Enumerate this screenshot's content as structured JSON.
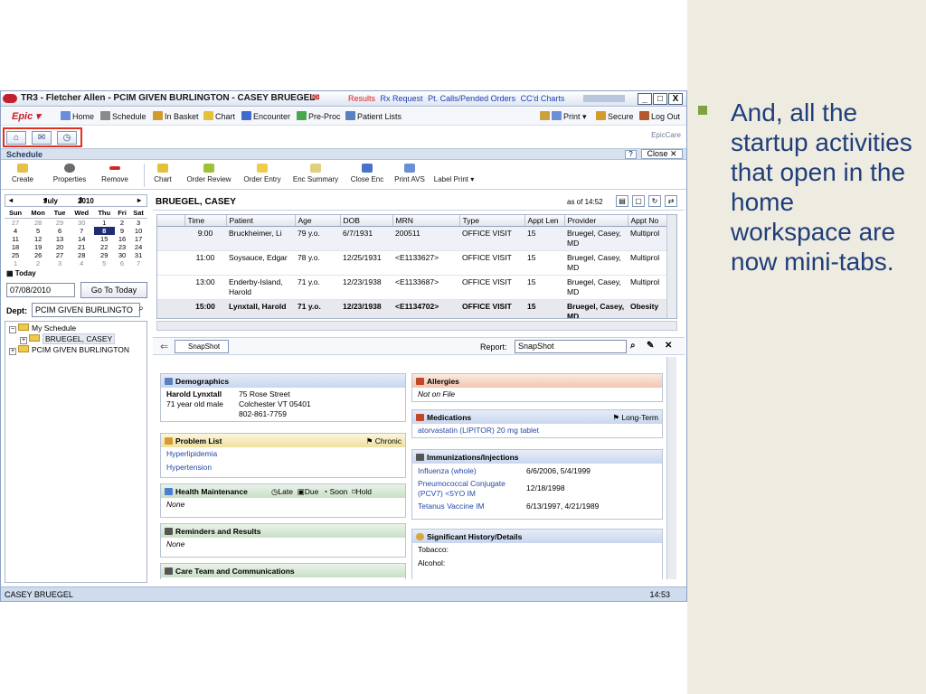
{
  "window": {
    "title": "TR3 - Fletcher Allen - PCIM GIVEN BURLINGTON - CASEY BRUEGEL",
    "links": [
      "Results",
      "Rx Request",
      "Pt. Calls/Pended Orders",
      "CC'd Charts"
    ],
    "min": "_",
    "max": "□",
    "close": "X"
  },
  "toolbar": {
    "epic": "Epic",
    "items": [
      "Home",
      "Schedule",
      "In Basket",
      "Chart",
      "Encounter",
      "Pre-Proc",
      "Patient Lists"
    ],
    "right": [
      "Print",
      "Secure",
      "Log Out"
    ],
    "brand": "EpicCare"
  },
  "minitabs": [
    "home-icon",
    "inbasket-icon",
    "clock-icon"
  ],
  "section": {
    "title": "Schedule",
    "help": "?",
    "close": "Close ✕"
  },
  "actions_left": [
    "Create",
    "Properties",
    "Remove"
  ],
  "actions_right": [
    "Chart",
    "Order Review",
    "Order Entry",
    "Enc Summary",
    "Close Enc",
    "Print AVS",
    "Label Print"
  ],
  "calendar": {
    "month": "July",
    "year": "2010",
    "days": [
      "Sun",
      "Mon",
      "Tue",
      "Wed",
      "Thu",
      "Fri",
      "Sat"
    ],
    "weeks": [
      [
        "27",
        "28",
        "29",
        "30",
        "1",
        "2",
        "3"
      ],
      [
        "4",
        "5",
        "6",
        "7",
        "8",
        "9",
        "10"
      ],
      [
        "11",
        "12",
        "13",
        "14",
        "15",
        "16",
        "17"
      ],
      [
        "18",
        "19",
        "20",
        "21",
        "22",
        "23",
        "24"
      ],
      [
        "25",
        "26",
        "27",
        "28",
        "29",
        "30",
        "31"
      ],
      [
        "1",
        "2",
        "3",
        "4",
        "5",
        "6",
        "7"
      ]
    ],
    "today_label": "Today",
    "selected": "8"
  },
  "date_input": "07/08/2010",
  "goto_label": "Go To Today",
  "dept": {
    "label": "Dept:",
    "value": "PCIM GIVEN BURLINGTO"
  },
  "tree": [
    {
      "label": "My Schedule",
      "level": "root"
    },
    {
      "label": "BRUEGEL, CASEY",
      "level": "child"
    },
    {
      "label": "PCIM GIVEN BURLINGTON",
      "level": "root"
    }
  ],
  "patient_header": {
    "name": "BRUEGEL, CASEY",
    "as_of": "as of 14:52"
  },
  "schedule": {
    "columns": [
      "Time",
      "Patient",
      "Age",
      "DOB",
      "MRN",
      "Type",
      "Appt Len",
      "Provider",
      "Appt No"
    ],
    "rows": [
      [
        "9:00",
        "Bruckheimer, Li",
        "79 y.o.",
        "6/7/1931",
        "200511",
        "OFFICE VISIT",
        "15",
        "Bruegel, Casey, MD",
        "Multiprol"
      ],
      [
        "11:00",
        "Soysauce, Edgar",
        "78 y.o.",
        "12/25/1931",
        "<E1133627>",
        "OFFICE VISIT",
        "15",
        "Bruegel, Casey, MD",
        "Multiprol"
      ],
      [
        "13:00",
        "Enderby-Island, Harold",
        "71 y.o.",
        "12/23/1938",
        "<E1133687>",
        "OFFICE VISIT",
        "15",
        "Bruegel, Casey, MD",
        "Multiprol"
      ],
      [
        "15:00",
        "Lynxtall, Harold",
        "71 y.o.",
        "12/23/1938",
        "<E1134702>",
        "OFFICE VISIT",
        "15",
        "Bruegel, Casey, MD",
        "Obesity"
      ]
    ]
  },
  "snapshot": {
    "tab": "SnapShot",
    "report_label": "Report:",
    "report_value": "SnapShot"
  },
  "demographics": {
    "title": "Demographics",
    "name": "Harold Lynxtall",
    "desc": "71 year old male",
    "addr1": "75 Rose Street",
    "addr2": "Colchester VT 05401",
    "phone": "802-861-7759"
  },
  "problem_list": {
    "title": "Problem List",
    "flag": "Chronic",
    "items": [
      "Hyperlipidemia",
      "Hypertension"
    ]
  },
  "health_maint": {
    "title": "Health Maintenance",
    "tags": [
      "Late",
      "Due",
      "Soon",
      "Hold"
    ],
    "value": "None"
  },
  "reminders": {
    "title": "Reminders and Results",
    "value": "None"
  },
  "care_team": {
    "title": "Care Team and Communications"
  },
  "allergies": {
    "title": "Allergies",
    "value": "Not on File"
  },
  "medications": {
    "title": "Medications",
    "flag": "Long-Term",
    "items": [
      "atorvastatin (LIPITOR) 20 mg tablet"
    ]
  },
  "immunizations": {
    "title": "Immunizations/Injections",
    "items": [
      {
        "name": "Influenza (whole)",
        "dates": "6/6/2006, 5/4/1999"
      },
      {
        "name": "Pneumococcal Conjugate (PCV7) <5YO IM",
        "dates": "12/18/1998"
      },
      {
        "name": "Tetanus Vaccine IM",
        "dates": "6/13/1997, 4/21/1989"
      }
    ]
  },
  "history": {
    "title": "Significant History/Details",
    "items": [
      "Tobacco:",
      "Alcohol:"
    ]
  },
  "status": {
    "user": "CASEY BRUEGEL",
    "time": "14:53"
  },
  "slide": {
    "text": "And, all the startup activities that open in the home workspace are now mini-tabs."
  },
  "colors": {
    "accent_red": "#c4202c",
    "slide_bg": "#eeebe1",
    "slide_text": "#1f3e7a",
    "bullet": "#7fa33c",
    "highlight_box": "#e0301e"
  }
}
